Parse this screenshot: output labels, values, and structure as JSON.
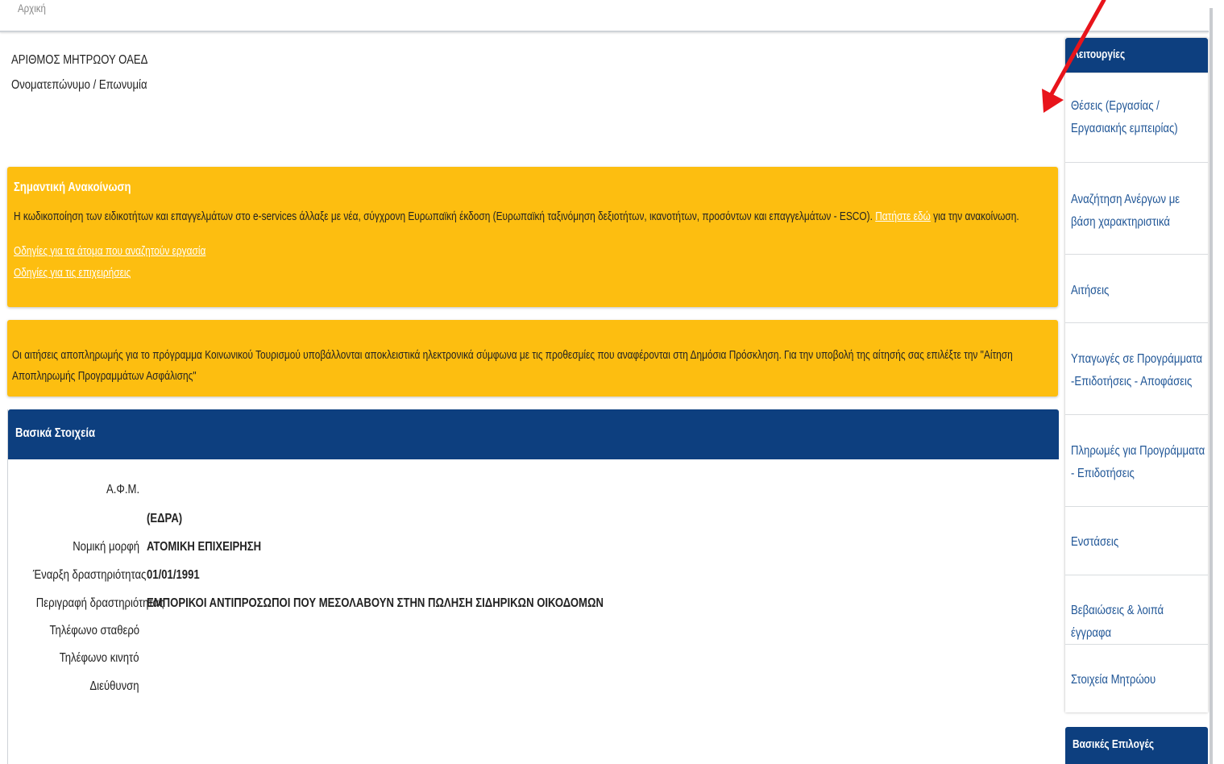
{
  "breadcrumb": "Αρχική",
  "header": {
    "registry_label": "ΑΡΙΘΜΟΣ ΜΗΤΡΩΟΥ ΟΑΕΔ",
    "name_label": "Ονοματεπώνυμο / Επωνυμία"
  },
  "notice1": {
    "title": "Σημαντική Ανακοίνωση",
    "text": "Η κωδικοποίηση των ειδικοτήτων και επαγγελμάτων στο e-services άλλαξε με νέα, σύγχρονη Ευρωπαϊκή έκδοση (Ευρωπαϊκή ταξινόμηση δεξιοτήτων, ικανοτήτων, προσόντων και επαγγελμάτων - ESCO).",
    "link_text": "Πατήστε εδώ",
    "text_after": "για την ανακοίνωση.",
    "link_jobseekers": "Οδηγίες για τα άτομα που αναζητούν εργασία",
    "link_businesses": "Οδηγίες για τις επιχειρήσεις"
  },
  "notice2": {
    "text": "Οι αιτήσεις αποπληρωμής για το πρόγραμμα Κοινωνικού Τουρισμού υποβάλλονται αποκλειστικά ηλεκτρονικά σύμφωνα με τις προθεσμίες που αναφέρονται στη Δημόσια Πρόσκληση. Για την υποβολή της αίτησής σας επιλέξτε την \"Αίτηση Αποπληρωμής Προγραμμάτων Ασφάλισης\""
  },
  "basic_info": {
    "title": "Βασικά Στοιχεία",
    "fields": [
      {
        "label": "Α.Φ.Μ.",
        "value": ""
      },
      {
        "label": "",
        "value": "(ΕΔΡΑ)"
      },
      {
        "label": "Νομική μορφή",
        "value": "ΑΤΟΜΙΚΗ ΕΠΙΧΕΙΡΗΣΗ"
      },
      {
        "label": "Έναρξη δραστηριότητας",
        "value": "01/01/1991"
      },
      {
        "label": "Περιγραφή δραστηριότητας",
        "value": "ΕΜΠΟΡΙΚΟΙ ΑΝΤΙΠΡΟΣΩΠΟΙ ΠΟΥ ΜΕΣΟΛΑΒΟΥΝ ΣΤΗΝ ΠΩΛΗΣΗ ΣΙΔΗΡΙΚΩΝ ΟΙΚΟΔΟΜΩΝ"
      },
      {
        "label": "Τηλέφωνο σταθερό",
        "value": ""
      },
      {
        "label": "Τηλέφωνο κινητό",
        "value": ""
      },
      {
        "label": "Διεύθυνση",
        "value": ""
      }
    ]
  },
  "sidebar": {
    "title": "Λειτουργίες",
    "items": [
      {
        "label": "Θέσεις (Εργασίας / Εργασιακής εμπειρίας)"
      },
      {
        "label": "Αναζήτηση Ανέργων με βάση χαρακτηριστικά"
      },
      {
        "label": "Αιτήσεις"
      },
      {
        "label": "Υπαγωγές σε Προγράμματα -Επιδοτήσεις - Αποφάσεις"
      },
      {
        "label": "Πληρωμές για Προγράμματα - Επιδοτήσεις"
      },
      {
        "label": "Ενστάσεις"
      },
      {
        "label": "Βεβαιώσεις & λοιπά έγγραφα"
      },
      {
        "label": "Στοιχεία Μητρώου"
      }
    ],
    "second_title": "Βασικές Επιλογές"
  },
  "colors": {
    "navy": "#0d3f7f",
    "notice_yellow": "#fdbe10",
    "link_blue": "#1f5596",
    "annotation_red": "#e8141b"
  },
  "icons": {
    "annotation": "red-arrow-icon"
  }
}
